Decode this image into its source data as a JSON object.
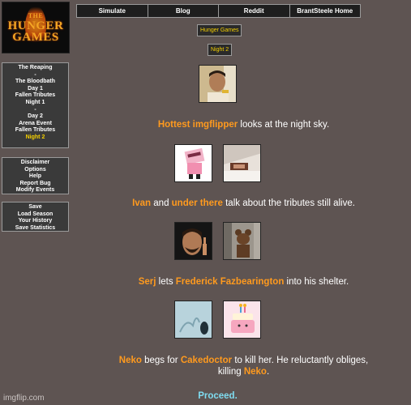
{
  "logo": {
    "line1": "THE",
    "line2": "HUNGER",
    "line3": "GAMES"
  },
  "nav": [
    "Simulate",
    "Blog",
    "Reddit",
    "BrantSteele Home"
  ],
  "sidebar": {
    "progress": [
      "The Reaping",
      "-",
      "The Bloodbath",
      "Day 1",
      "Fallen Tributes",
      "Night 1",
      "-",
      "Day 2",
      "Arena Event",
      "Fallen Tributes",
      "Night 2"
    ],
    "current_index": 10,
    "info": [
      "Disclaimer",
      "Options",
      "Help",
      "Report Bug",
      "Modify Events"
    ],
    "save": [
      "Save",
      "Load Season",
      "Your History",
      "Save Statistics"
    ]
  },
  "header": {
    "game_title": "Hunger Games",
    "phase": "Night 2"
  },
  "events": [
    {
      "parts": [
        {
          "name": "Hottest imgflipper"
        },
        {
          "text": " looks at the night sky."
        }
      ]
    },
    {
      "parts": [
        {
          "name": "Ivan"
        },
        {
          "text": " and "
        },
        {
          "name": "under there"
        },
        {
          "text": " talk about the tributes still alive."
        }
      ]
    },
    {
      "parts": [
        {
          "name": "Serj"
        },
        {
          "text": " lets "
        },
        {
          "name": "Frederick Fazbearington"
        },
        {
          "text": " into his shelter."
        }
      ]
    },
    {
      "parts": [
        {
          "name": "Neko"
        },
        {
          "text": " begs for "
        },
        {
          "name": "Cakedoctor"
        },
        {
          "text": " to kill her. He reluctantly obliges,"
        }
      ],
      "parts2": [
        {
          "text": "killing "
        },
        {
          "name": "Neko"
        },
        {
          "text": "."
        }
      ]
    }
  ],
  "proceed": "Proceed.",
  "watermark": "imgflip.com"
}
